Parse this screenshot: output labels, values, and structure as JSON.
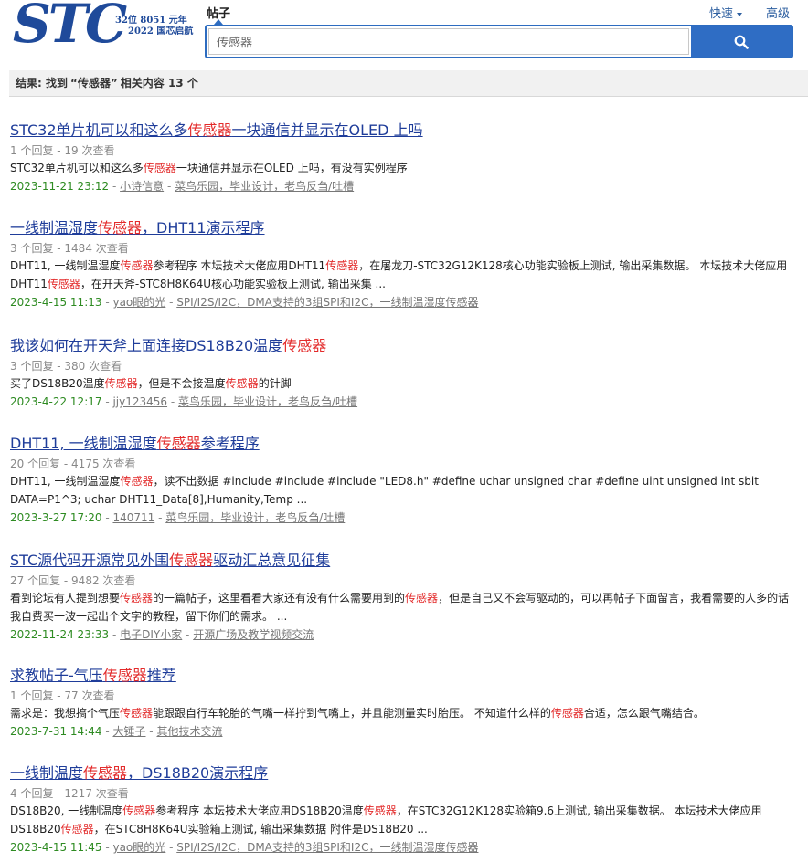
{
  "header": {
    "logo_text": "STC",
    "logo_tag1": "32位 8051 元年",
    "logo_tag2": "2022 国芯启航",
    "scope_label": "帖子",
    "quick_label": "快速",
    "advanced_label": "高级",
    "search_value": "传感器"
  },
  "result_bar": {
    "prefix": "结果: 找到",
    "keyword": "“传感器”",
    "suffix": "相关内容 13 个"
  },
  "results": [
    {
      "title": [
        {
          "t": "STC32单片机可以和这么多"
        },
        {
          "t": "传感器",
          "hl": true
        },
        {
          "t": "一块通信并显示在OLED 上吗"
        }
      ],
      "meta": "1 个回复 - 19 次查看",
      "snippet": [
        {
          "t": "STC32单片机可以和这么多"
        },
        {
          "t": "传感器",
          "hl": true
        },
        {
          "t": "一块通信并显示在OLED 上吗，有没有实例程序"
        }
      ],
      "date": "2023-11-21 23:12",
      "author": "小诗信意",
      "category": "菜鸟乐园，毕业设计，老鸟反刍/吐槽"
    },
    {
      "title": [
        {
          "t": "一线制温湿度"
        },
        {
          "t": "传感器",
          "hl": true
        },
        {
          "t": "，DHT11演示程序"
        }
      ],
      "meta": "3 个回复 - 1484 次查看",
      "snippet": [
        {
          "t": "DHT11, 一线制温湿度"
        },
        {
          "t": "传感器",
          "hl": true
        },
        {
          "t": "参考程序 本坛技术大佬应用DHT11"
        },
        {
          "t": "传感器",
          "hl": true
        },
        {
          "t": "，在屠龙刀-STC32G12K128核心功能实验板上测试, 输出采集数据。 本坛技术大佬应用DHT11"
        },
        {
          "t": "传感器",
          "hl": true
        },
        {
          "t": "，在开天斧-STC8H8K64U核心功能实验板上测试, 输出采集 ..."
        }
      ],
      "date": "2023-4-15 11:13",
      "author": "yao眼的光",
      "category": "SPI/I2S/I2C，DMA支持的3组SPI和I2C，一线制温湿度传感器"
    },
    {
      "title": [
        {
          "t": "我该如何在开天斧上面连接DS18B20温度"
        },
        {
          "t": "传感器",
          "hl": true
        }
      ],
      "meta": "3 个回复 - 380 次查看",
      "snippet": [
        {
          "t": "买了DS18B20温度"
        },
        {
          "t": "传感器",
          "hl": true
        },
        {
          "t": "，但是不会接温度"
        },
        {
          "t": "传感器",
          "hl": true
        },
        {
          "t": "的针脚"
        }
      ],
      "date": "2023-4-22 12:17",
      "author": "jjy123456",
      "category": "菜鸟乐园，毕业设计，老鸟反刍/吐槽"
    },
    {
      "title": [
        {
          "t": "DHT11, 一线制温湿度"
        },
        {
          "t": "传感器",
          "hl": true
        },
        {
          "t": "参考程序"
        }
      ],
      "meta": "20 个回复 - 4175 次查看",
      "snippet": [
        {
          "t": "DHT11, 一线制温湿度"
        },
        {
          "t": "传感器",
          "hl": true
        },
        {
          "t": "，读不出数据 #include #include #include \"LED8.h\" #define uchar unsigned char #define uint unsigned int sbit DATA=P1^3; uchar DHT11_Data[8],Humanity,Temp ..."
        }
      ],
      "date": "2023-3-27 17:20",
      "author": "140711",
      "category": "菜鸟乐园，毕业设计，老鸟反刍/吐槽"
    },
    {
      "title": [
        {
          "t": "STC源代码开源常见外围"
        },
        {
          "t": "传感器",
          "hl": true
        },
        {
          "t": "驱动汇总意见征集"
        }
      ],
      "meta": "27 个回复 - 9482 次查看",
      "snippet": [
        {
          "t": "看到论坛有人提到想要"
        },
        {
          "t": "传感器",
          "hl": true
        },
        {
          "t": "的一篇帖子，这里看看大家还有没有什么需要用到的"
        },
        {
          "t": "传感器",
          "hl": true
        },
        {
          "t": "，但是自己又不会写驱动的，可以再帖子下面留言，我看需要的人多的话我自费买一波一起出个文字的教程，留下你们的需求。 ..."
        }
      ],
      "date": "2022-11-24 23:33",
      "author": "电子DIY小家",
      "category": "开源广场及教学视频交流"
    },
    {
      "title": [
        {
          "t": "求教帖子-气压"
        },
        {
          "t": "传感器",
          "hl": true
        },
        {
          "t": "推荐"
        }
      ],
      "meta": "1 个回复 - 77 次查看",
      "snippet": [
        {
          "t": "需求是：我想搞个气压"
        },
        {
          "t": "传感器",
          "hl": true
        },
        {
          "t": "能跟跟自行车轮胎的气嘴一样拧到气嘴上，并且能测量实时胎压。 不知道什么样的"
        },
        {
          "t": "传感器",
          "hl": true
        },
        {
          "t": "合适，怎么跟气嘴结合。"
        }
      ],
      "date": "2023-7-31 14:44",
      "author": "大锤子",
      "category": "其他技术交流"
    },
    {
      "title": [
        {
          "t": "一线制温度"
        },
        {
          "t": "传感器",
          "hl": true
        },
        {
          "t": "，DS18B20演示程序"
        }
      ],
      "meta": "4 个回复 - 1217 次查看",
      "snippet": [
        {
          "t": "DS18B20, 一线制温度"
        },
        {
          "t": "传感器",
          "hl": true
        },
        {
          "t": "参考程序 本坛技术大佬应用DS18B20温度"
        },
        {
          "t": "传感器",
          "hl": true
        },
        {
          "t": "，在STC32G12K128实验箱9.6上测试, 输出采集数据。 本坛技术大佬应用DS18B20"
        },
        {
          "t": "传感器",
          "hl": true
        },
        {
          "t": "，在STC8H8K64U实验箱上测试, 输出采集数据 附件是DS18B20 ..."
        }
      ],
      "date": "2023-4-15 11:45",
      "author": "yao眼的光",
      "category": "SPI/I2S/I2C，DMA支持的3组SPI和I2C，一线制温湿度传感器"
    }
  ]
}
